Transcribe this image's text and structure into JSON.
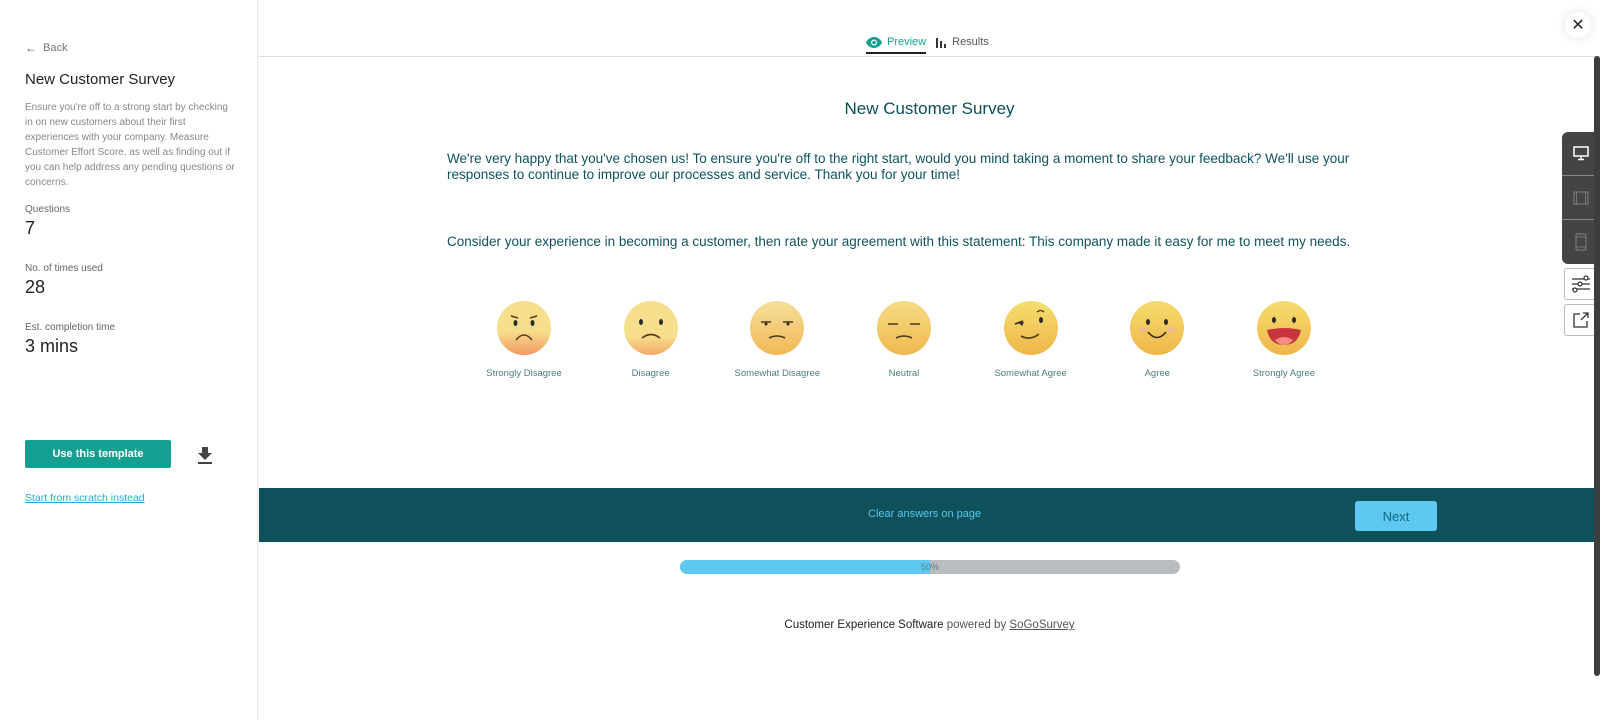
{
  "sidebar": {
    "back_label": "Back",
    "title": "New Customer Survey",
    "description": "Ensure you're off to a strong start by checking in on new customers about their first experiences with your company. Measure Customer Effort Score, as well as finding out if you can help address any pending questions or concerns.",
    "stats": [
      {
        "label": "Questions",
        "value": "7"
      },
      {
        "label": "No. of times used",
        "value": "28"
      },
      {
        "label": "Est. completion time",
        "value": "3 mins"
      }
    ],
    "use_template_label": "Use this template",
    "download_icon": "download-icon",
    "scratch_link": "Start from scratch instead"
  },
  "tabs": [
    {
      "label": "Preview",
      "icon": "eye-icon",
      "active": true
    },
    {
      "label": "Results",
      "icon": "bar-chart-icon",
      "active": false
    }
  ],
  "close_icon": "close-icon",
  "survey": {
    "title": "New Customer Survey",
    "intro": "We're very happy that you've chosen us! To ensure you're off to the right start, would you mind taking a moment to share your feedback? We'll use your responses to continue to improve our processes and service. Thank you for your time!",
    "question": "Consider your experience in becoming a customer, then rate your agreement with this statement: This company made it easy for me to meet my needs.",
    "options": [
      {
        "label": "Strongly Disagree",
        "icon": "angry-face-icon"
      },
      {
        "label": "Disagree",
        "icon": "sad-face-icon"
      },
      {
        "label": "Somewhat Disagree",
        "icon": "annoyed-face-icon"
      },
      {
        "label": "Neutral",
        "icon": "neutral-face-icon"
      },
      {
        "label": "Somewhat Agree",
        "icon": "smirk-face-icon"
      },
      {
        "label": "Agree",
        "icon": "smile-face-icon"
      },
      {
        "label": "Strongly Agree",
        "icon": "laughing-face-icon"
      }
    ],
    "clear_label": "Clear answers on page",
    "next_label": "Next",
    "progress_percent": 50,
    "progress_label": "50%"
  },
  "footer": {
    "bold": "Customer Experience Software",
    "middle": " powered by ",
    "link": "SoGoSurvey"
  },
  "device_toolbar": [
    {
      "icon": "desktop-icon",
      "active": true
    },
    {
      "icon": "tablet-icon",
      "active": false
    },
    {
      "icon": "mobile-icon",
      "active": false
    }
  ],
  "tools": [
    {
      "icon": "settings-sliders-icon"
    },
    {
      "icon": "external-link-icon"
    }
  ],
  "colors": {
    "brand": "#13a091",
    "dark_teal": "#0f515b",
    "accent_blue": "#5ec8f0",
    "text_teal": "#0e5460"
  }
}
